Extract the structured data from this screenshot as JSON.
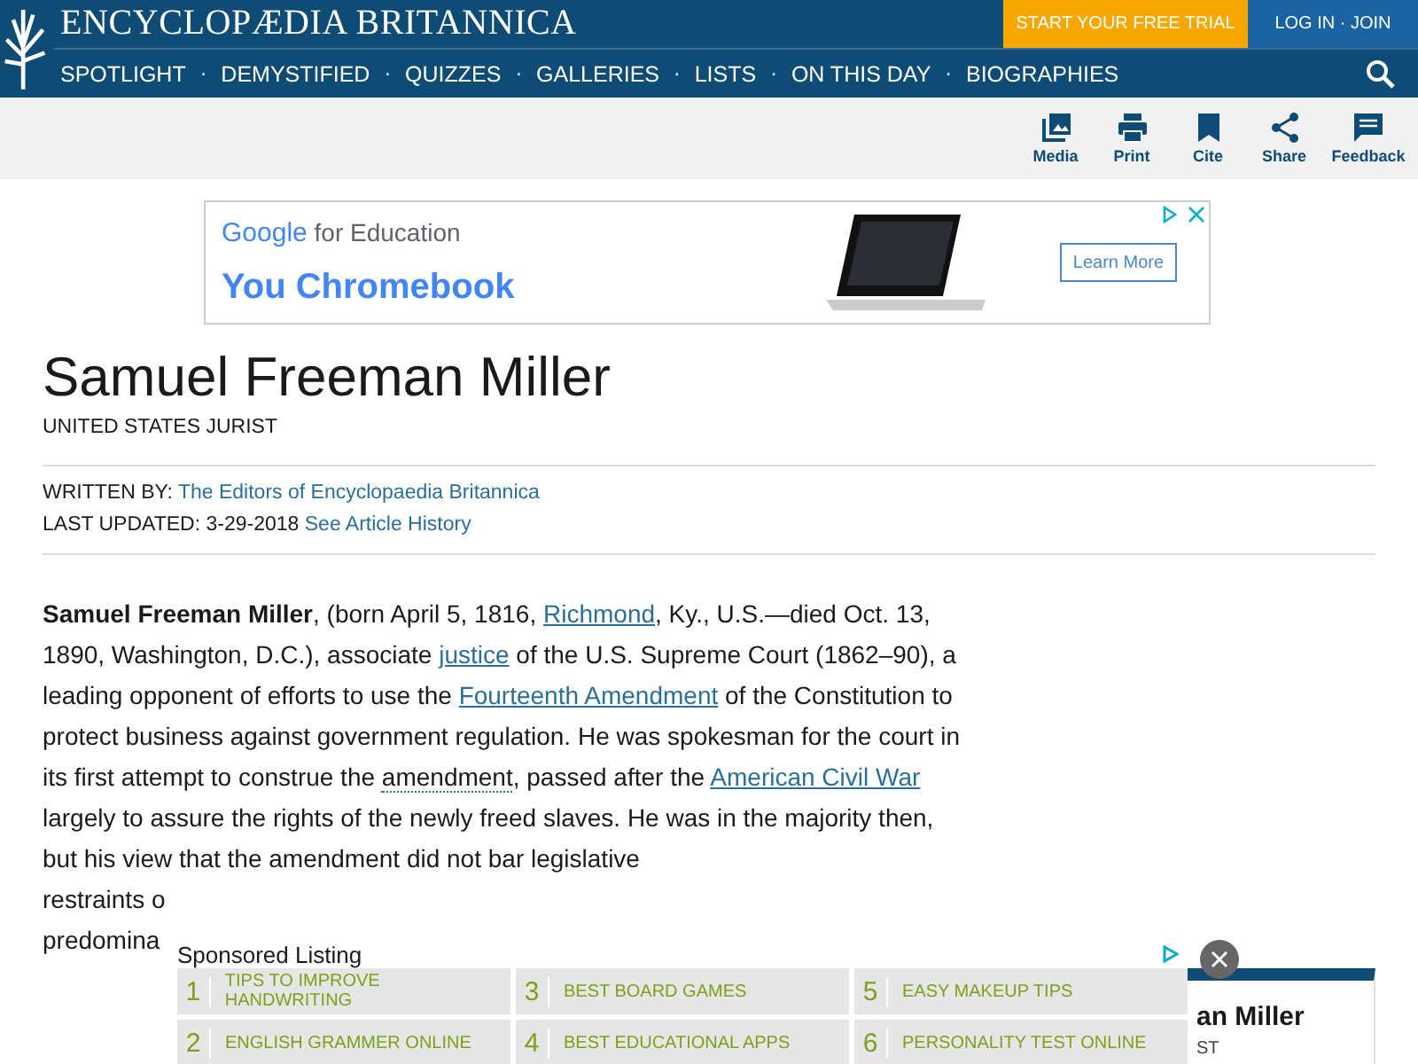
{
  "header": {
    "brand": "ENCYCLOPÆDIA BRITANNICA",
    "trial_button": "START YOUR FREE TRIAL",
    "login_link": "LOG IN · JOIN",
    "nav": [
      "SPOTLIGHT",
      "DEMYSTIFIED",
      "QUIZZES",
      "GALLERIES",
      "LISTS",
      "ON THIS DAY",
      "BIOGRAPHIES"
    ],
    "separator": "·"
  },
  "toolbar": [
    {
      "kind": "media",
      "label": "Media"
    },
    {
      "kind": "print",
      "label": "Print"
    },
    {
      "kind": "cite",
      "label": "Cite"
    },
    {
      "kind": "share",
      "label": "Share"
    },
    {
      "kind": "feedback",
      "label": "Feedback"
    }
  ],
  "ad": {
    "logo": "Google",
    "brand_suffix": "for Education",
    "headline": "You Chromebook",
    "button": "Learn More"
  },
  "article": {
    "title": "Samuel Freeman Miller",
    "subtitle": "UNITED STATES JURIST",
    "written_by_label": "WRITTEN BY:",
    "author": "The Editors of Encyclopaedia Britannica",
    "updated_label": "LAST UPDATED: 3-29-2018",
    "history_link": "See Article History",
    "paragraph": [
      {
        "kind": "bold",
        "text": "Samuel Freeman Miller"
      },
      {
        "kind": "plain",
        "text": ", (born April 5, 1816, "
      },
      {
        "kind": "link",
        "text": "Richmond"
      },
      {
        "kind": "plain",
        "text": ", Ky., U.S.—died Oct. 13, 1890, Washington, D.C.), associate "
      },
      {
        "kind": "link",
        "text": "justice"
      },
      {
        "kind": "plain",
        "text": " of the U.S. Supreme Court (1862–90), a leading opponent of efforts to use the "
      },
      {
        "kind": "link",
        "text": "Fourteenth Amendment"
      },
      {
        "kind": "plain",
        "text": " of the Constitution to protect business against government regulation. He was spokesman for the court in its first attempt to construe the "
      },
      {
        "kind": "term",
        "text": "amendment"
      },
      {
        "kind": "plain",
        "text": ", passed after the "
      },
      {
        "kind": "link",
        "text": "American Civil War"
      },
      {
        "kind": "plain",
        "text": " largely to assure the rights of the newly freed slaves. He was in the majority then, but his view that the amendment did not bar legislative"
      }
    ],
    "cut_lines": [
      "restraints o",
      "predomina"
    ]
  },
  "side_card": {
    "title": "an Miller",
    "subtitle": "ST"
  },
  "sponsored": {
    "title": "Sponsored Listing",
    "items": [
      {
        "number": "1",
        "label": "TIPS TO IMPROVE HANDWRITING"
      },
      {
        "number": "3",
        "label": "BEST BOARD GAMES"
      },
      {
        "number": "5",
        "label": "EASY MAKEUP TIPS"
      },
      {
        "number": "2",
        "label": "ENGLISH GRAMMER ONLINE"
      },
      {
        "number": "4",
        "label": "BEST EDUCATIONAL APPS"
      },
      {
        "number": "6",
        "label": "PERSONALITY TEST ONLINE"
      }
    ]
  }
}
